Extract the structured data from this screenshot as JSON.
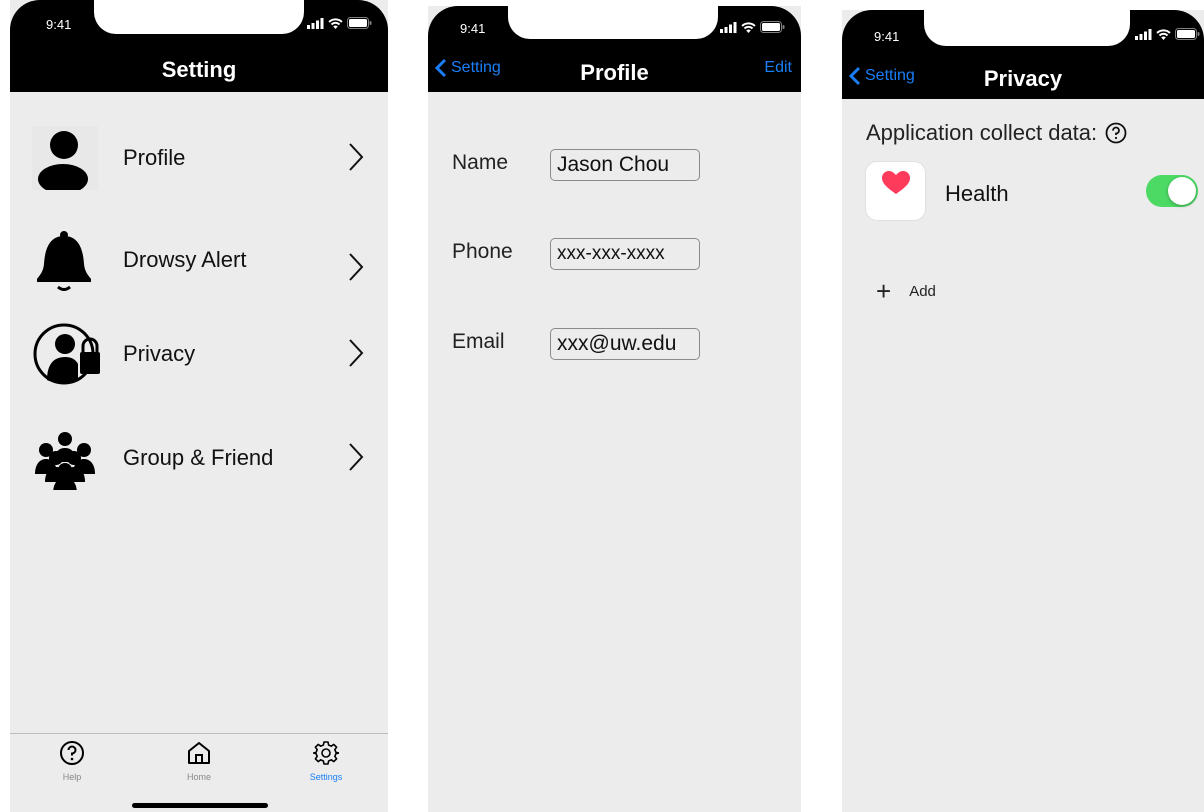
{
  "status_bar": {
    "time": "9:41"
  },
  "setting_screen": {
    "title": "Setting",
    "menu_items": [
      {
        "label": "Profile",
        "icon": "person-icon"
      },
      {
        "label": "Drowsy Alert",
        "icon": "bell-icon"
      },
      {
        "label": "Privacy",
        "icon": "user-lock-icon"
      },
      {
        "label": "Group & Friend",
        "icon": "group-icon"
      }
    ],
    "tab_bar": [
      {
        "label": "Help",
        "icon": "help-circle-icon",
        "active": false
      },
      {
        "label": "Home",
        "icon": "home-icon",
        "active": false
      },
      {
        "label": "Settings",
        "icon": "gear-icon",
        "active": true
      }
    ]
  },
  "profile_screen": {
    "back_label": "Setting",
    "title": "Profile",
    "edit_label": "Edit",
    "fields": [
      {
        "label": "Name",
        "value": "Jason Chou"
      },
      {
        "label": "Phone",
        "value": "xxx-xxx-xxxx"
      },
      {
        "label": "Email",
        "value": "xxx@uw.edu"
      }
    ]
  },
  "privacy_screen": {
    "back_label": "Setting",
    "title": "Privacy",
    "section_title": "Application collect data:",
    "apps": [
      {
        "label": "Health",
        "icon": "heart-icon",
        "enabled": true
      }
    ],
    "add_label": "Add"
  },
  "colors": {
    "accent": "#1a7ef7",
    "toggle_on": "#4cd964",
    "heart": "#ff3b5c",
    "background": "#ececec",
    "header": "#000000"
  }
}
